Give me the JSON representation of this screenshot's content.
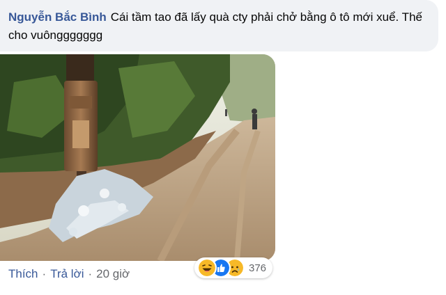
{
  "comment": {
    "author": "Nguyễn Bắc Bình",
    "text": "Cái tầm tao đã lấy quà cty phải chở bằng ô tô mới xuể. Thế cho vuônggggggg"
  },
  "actions": {
    "like": "Thích",
    "reply": "Trả lời",
    "separator": "·",
    "time": "20 giờ"
  },
  "reactions": {
    "icons": [
      "laugh-emoji-icon",
      "like-thumb-icon",
      "sad-emoji-icon"
    ],
    "count": "376"
  },
  "colors": {
    "author": "#385898",
    "bubble_bg": "#f0f2f5",
    "link": "#385898",
    "meta": "#65676b",
    "like_blue": "#1877f2",
    "emoji_yellow": "#f7b928"
  }
}
